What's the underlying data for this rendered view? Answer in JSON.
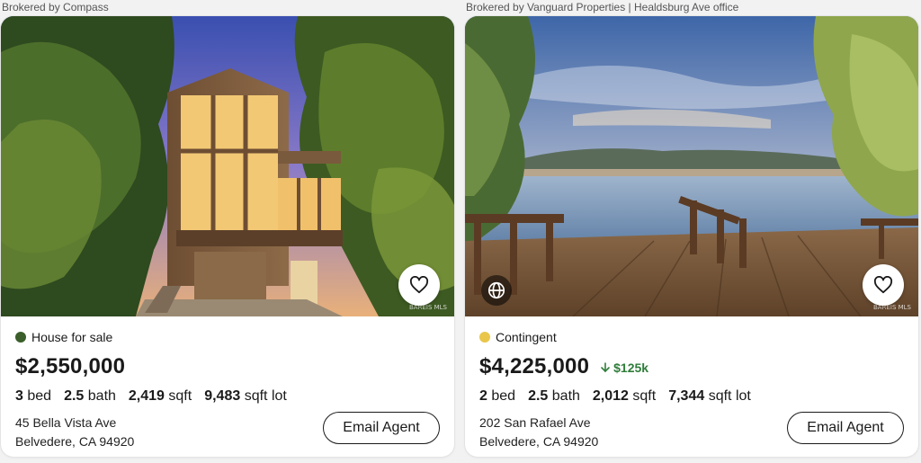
{
  "listings": [
    {
      "broker": "Brokered by Compass",
      "status": "House for sale",
      "status_color": "#3b5e2b",
      "price": "$2,550,000",
      "price_drop": "",
      "beds": "3",
      "beds_unit": "bed",
      "baths": "2.5",
      "baths_unit": "bath",
      "sqft": "2,419",
      "sqft_unit": "sqft",
      "lot": "9,483",
      "lot_unit": "sqft lot",
      "address_line1": "45 Bella Vista Ave",
      "address_line2": "Belvedere, CA 94920",
      "email_label": "Email Agent",
      "watermark": "BAREIS MLS"
    },
    {
      "broker": "Brokered by Vanguard Properties | Healdsburg Ave office",
      "status": "Contingent",
      "status_color": "#e9c64a",
      "price": "$4,225,000",
      "price_drop": "$125k",
      "beds": "2",
      "beds_unit": "bed",
      "baths": "2.5",
      "baths_unit": "bath",
      "sqft": "2,012",
      "sqft_unit": "sqft",
      "lot": "7,344",
      "lot_unit": "sqft lot",
      "address_line1": "202 San Rafael Ave",
      "address_line2": "Belvedere, CA 94920",
      "email_label": "Email Agent",
      "watermark": "BAREIS MLS"
    }
  ],
  "icons": {
    "favorite": "heart-icon",
    "virtual_tour": "globe-icon",
    "price_drop": "arrow-down-icon"
  },
  "colors": {
    "price_drop": "#2f7d3a"
  }
}
